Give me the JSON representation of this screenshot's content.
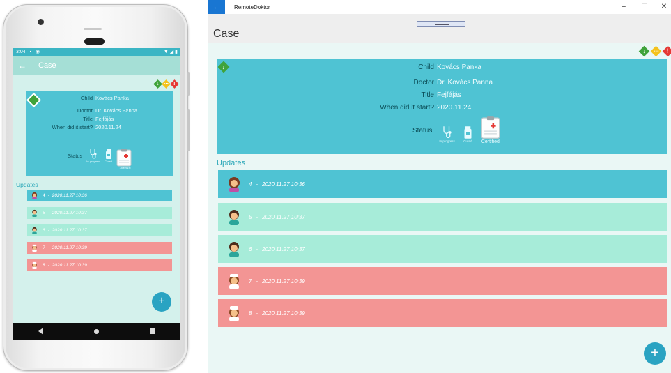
{
  "colors": {
    "card": "#4fc3d3",
    "update_teal": "#4fc3d3",
    "update_mint": "#a7ecd9",
    "update_red": "#f39594",
    "priority_green": "#3fa33a",
    "priority_yellow": "#f4c21c",
    "priority_red": "#e53935",
    "fab": "#2aa3c2",
    "window_back": "#1976d2"
  },
  "mobile": {
    "status": {
      "time": "3:04",
      "left_icons": [
        "sim-icon",
        "sync-icon"
      ],
      "right_icons": [
        "wifi-icon",
        "signal-icon",
        "battery-icon"
      ]
    },
    "appbar": {
      "back_icon": "back-arrow-icon",
      "title": "Case"
    }
  },
  "window": {
    "app_title": "RemoteDoktor",
    "back_icon": "back-arrow-icon",
    "controls": {
      "minimize": "–",
      "maximize": "☐",
      "close": "✕"
    },
    "page_title": "Case"
  },
  "priorities": [
    {
      "name": "priority-low",
      "glyph": "↓",
      "color": "#3fa33a"
    },
    {
      "name": "priority-medium",
      "glyph": "⋯",
      "color": "#f4c21c"
    },
    {
      "name": "priority-high",
      "glyph": "!",
      "color": "#e53935"
    }
  ],
  "case": {
    "fields": [
      {
        "label": "Child",
        "value": "Kovács Panka"
      },
      {
        "label": "Doctor",
        "value": "Dr. Kovács Panna"
      },
      {
        "label": "Title",
        "value": "Fejfájás"
      },
      {
        "label": "When did it start?",
        "value": "2020.11.24"
      }
    ],
    "status_label": "Status",
    "statuses": [
      {
        "label": "In progress",
        "icon": "stethoscope-icon"
      },
      {
        "label": "Cured",
        "icon": "pill-bottle-icon"
      },
      {
        "label": "Certified",
        "icon": "medical-certificate-icon"
      }
    ]
  },
  "updates_heading": "Updates",
  "updates": [
    {
      "id": "4",
      "separator": "-",
      "date": "2020.11.27 10:36",
      "color": "teal",
      "avatar": "patient-avatar-icon"
    },
    {
      "id": "5",
      "separator": "-",
      "date": "2020.11.27 10:37",
      "color": "mint",
      "avatar": "doctor-avatar-icon"
    },
    {
      "id": "6",
      "separator": "-",
      "date": "2020.11.27 10:37",
      "color": "mint",
      "avatar": "doctor-avatar-icon"
    },
    {
      "id": "7",
      "separator": "-",
      "date": "2020.11.27 10:39",
      "color": "red",
      "avatar": "nurse-avatar-icon"
    },
    {
      "id": "8",
      "separator": "-",
      "date": "2020.11.27 10:39",
      "color": "red",
      "avatar": "nurse-avatar-icon"
    }
  ],
  "fab": {
    "label": "+"
  },
  "navbar": {
    "icons": [
      "back-triangle-icon",
      "home-circle-icon",
      "recents-square-icon"
    ]
  }
}
